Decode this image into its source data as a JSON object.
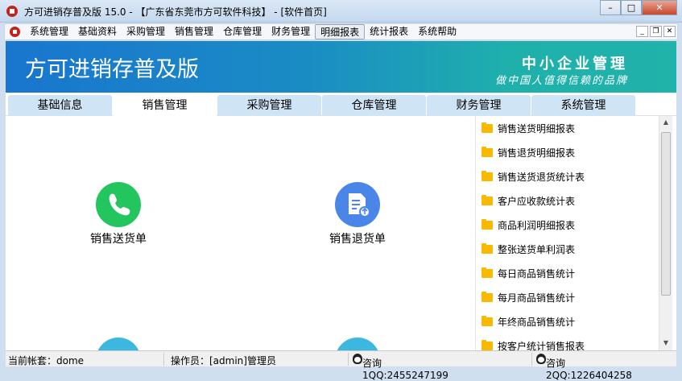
{
  "window": {
    "title": "方可进销存普及版 15.0 - 【广东省东莞市方可软件科技】 - [软件首页]",
    "min": "–",
    "max": "□",
    "close": "✕"
  },
  "menu": [
    "系统管理",
    "基础资料",
    "采购管理",
    "销售管理",
    "仓库管理",
    "财务管理",
    "明细报表",
    "统计报表",
    "系统帮助"
  ],
  "banner": {
    "app_name": "方可进销存普及版",
    "slogan1": "中小企业管理",
    "slogan2": "做中国人值得信赖的品牌"
  },
  "tabs": [
    "基础信息",
    "销售管理",
    "采购管理",
    "仓库管理",
    "财务管理",
    "系统管理"
  ],
  "tiles": [
    {
      "label": "销售送货单",
      "color": "#22c55e"
    },
    {
      "label": "销售退货单",
      "color": "#4a86e8"
    }
  ],
  "reports": [
    "销售送货明细报表",
    "销售退货明细报表",
    "销售送货退货统计表",
    "客户应收款统计表",
    "商品利润明细报表",
    "整张送货单利润表",
    "每日商品销售统计",
    "每月商品销售统计",
    "年终商品销售统计",
    "按客户统计销售报表"
  ],
  "status": {
    "account": "当前帐套：dome",
    "operator": "操作员：[admin]管理员",
    "qq1": "咨询1QQ:2455247199",
    "qq2": "咨询2QQ:1226404258"
  }
}
